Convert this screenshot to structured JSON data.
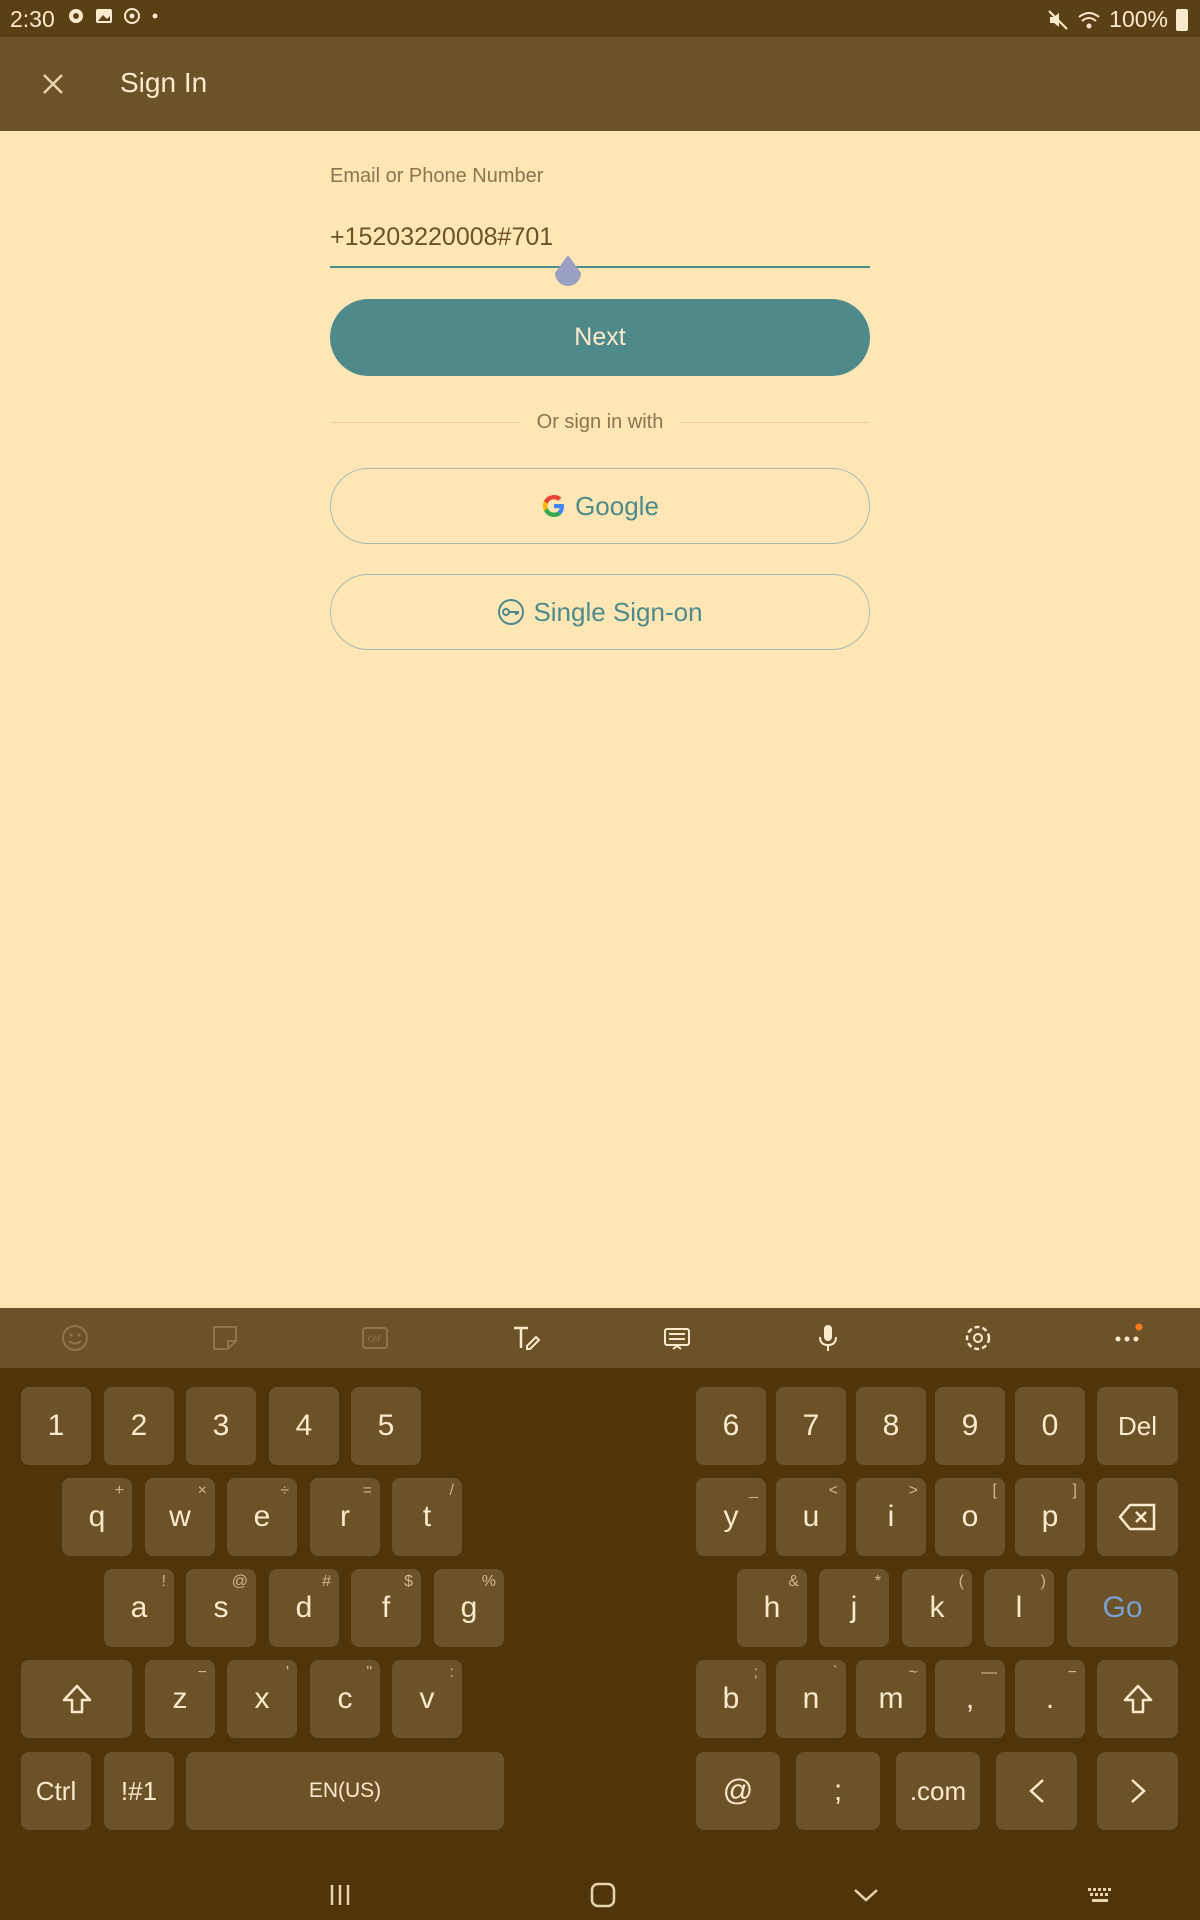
{
  "status": {
    "time": "2:30",
    "battery": "100%"
  },
  "app_bar": {
    "title": "Sign In"
  },
  "form": {
    "label": "Email or Phone Number",
    "value": "+15203220008#701",
    "next_label": "Next",
    "divider_text": "Or sign in with",
    "google_label": "Google",
    "sso_label": "Single Sign-on"
  },
  "keyboard": {
    "space_label": "EN(US)",
    "go_label": "Go",
    "keys": {
      "r0": [
        "1",
        "2",
        "3",
        "4",
        "5",
        "6",
        "7",
        "8",
        "9",
        "0",
        "Del"
      ],
      "r1": [
        "q",
        "w",
        "e",
        "r",
        "t",
        "y",
        "u",
        "i",
        "o",
        "p"
      ],
      "r1_sup": [
        "+",
        "×",
        "÷",
        "=",
        "/",
        "_",
        "<",
        ">",
        "[",
        "]"
      ],
      "r2": [
        "a",
        "s",
        "d",
        "f",
        "g",
        "h",
        "j",
        "k",
        "l"
      ],
      "r2_sup": [
        "!",
        "@",
        "#",
        "$",
        "%",
        "&",
        "*",
        "(",
        ")"
      ],
      "r3": [
        "z",
        "x",
        "c",
        "v",
        "b",
        "n",
        "m",
        ",",
        "."
      ],
      "r3_sup": [
        "−",
        "'",
        "\"",
        ":",
        ";",
        "`",
        "~",
        "—",
        "−"
      ],
      "r4": [
        "Ctrl",
        "!#1",
        "@",
        ";",
        ".com"
      ]
    }
  }
}
